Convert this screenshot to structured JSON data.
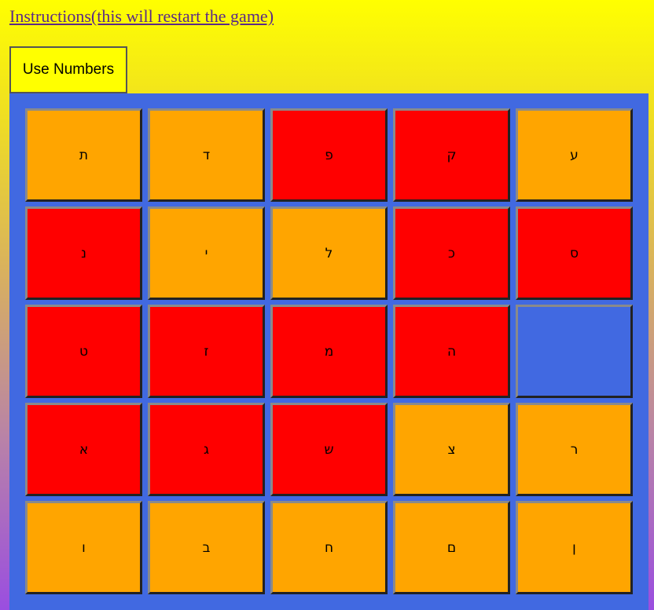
{
  "header": {
    "instructions_link": "Instructions(this will restart the game)",
    "mode_button": "Use Numbers"
  },
  "colors": {
    "orange": "#ffa500",
    "red": "#ff0000",
    "board": "#4169e1",
    "button": "#ffff00"
  },
  "board": {
    "rows": [
      [
        {
          "letter": "ת",
          "color": "orange"
        },
        {
          "letter": "ד",
          "color": "orange"
        },
        {
          "letter": "פ",
          "color": "red"
        },
        {
          "letter": "ק",
          "color": "red"
        },
        {
          "letter": "ע",
          "color": "orange"
        }
      ],
      [
        {
          "letter": "נ",
          "color": "red"
        },
        {
          "letter": "י",
          "color": "orange"
        },
        {
          "letter": "ל",
          "color": "orange"
        },
        {
          "letter": "כ",
          "color": "red"
        },
        {
          "letter": "ס",
          "color": "red"
        }
      ],
      [
        {
          "letter": "ט",
          "color": "red"
        },
        {
          "letter": "ז",
          "color": "red"
        },
        {
          "letter": "מ",
          "color": "red"
        },
        {
          "letter": "ה",
          "color": "red"
        },
        {
          "letter": "",
          "color": "empty"
        }
      ],
      [
        {
          "letter": "א",
          "color": "red"
        },
        {
          "letter": "ג",
          "color": "red"
        },
        {
          "letter": "ש",
          "color": "red"
        },
        {
          "letter": "צ",
          "color": "orange"
        },
        {
          "letter": "ר",
          "color": "orange"
        }
      ],
      [
        {
          "letter": "ו",
          "color": "orange"
        },
        {
          "letter": "ב",
          "color": "orange"
        },
        {
          "letter": "ח",
          "color": "orange"
        },
        {
          "letter": "ם",
          "color": "orange"
        },
        {
          "letter": "ן",
          "color": "orange"
        }
      ]
    ]
  }
}
